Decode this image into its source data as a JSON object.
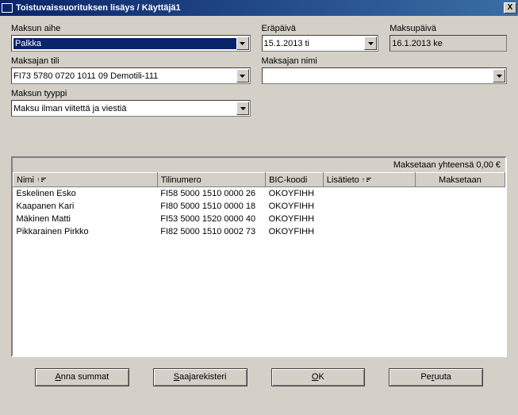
{
  "window": {
    "title": "Toistuvaissuorituksen lisäys / Käyttäjä1",
    "close": "X"
  },
  "labels": {
    "maksun_aihe": "Maksun aihe",
    "erapaiva": "Eräpäivä",
    "maksupaiva": "Maksupäivä",
    "maksajan_tili": "Maksajan tili",
    "maksajan_nimi": "Maksajan nimi",
    "maksun_tyyppi": "Maksun tyyppi"
  },
  "values": {
    "maksun_aihe": "Palkka",
    "erapaiva": "15.1.2013 ti",
    "maksupaiva": "16.1.2013 ke",
    "maksajan_tili": "FI73 5780 0720 1011 09   Demotili-111",
    "maksajan_nimi": "",
    "maksun_tyyppi": "Maksu ilman viitettä ja viestiä"
  },
  "total": "Maksetaan yhteensä 0,00 €",
  "columns": {
    "nimi": "Nimi",
    "tilinumero": "Tilinumero",
    "bic": "BIC-koodi",
    "lisatieto": "Lisätieto",
    "maksetaan": "Maksetaan"
  },
  "rows": [
    {
      "nimi": "Eskelinen Esko",
      "tili": "FI58 5000 1510 0000 26",
      "bic": "OKOYFIHH",
      "lisa": "",
      "maks": ""
    },
    {
      "nimi": "Kaapanen Kari",
      "tili": "FI80 5000 1510 0000 18",
      "bic": "OKOYFIHH",
      "lisa": "",
      "maks": ""
    },
    {
      "nimi": "Mäkinen Matti",
      "tili": "FI53 5000 1520 0000 40",
      "bic": "OKOYFIHH",
      "lisa": "",
      "maks": ""
    },
    {
      "nimi": "Pikkarainen Pirkko",
      "tili": "FI82 5000 1510 0002 73",
      "bic": "OKOYFIHH",
      "lisa": "",
      "maks": ""
    }
  ],
  "buttons": {
    "anna_summat": {
      "u": "A",
      "rest": "nna summat"
    },
    "saajarekisteri": {
      "u": "S",
      "rest": "aajarekisteri"
    },
    "ok": {
      "u": "O",
      "rest": "K"
    },
    "peruuta": {
      "pre": "Pe",
      "u": "r",
      "post": "uuta"
    }
  }
}
